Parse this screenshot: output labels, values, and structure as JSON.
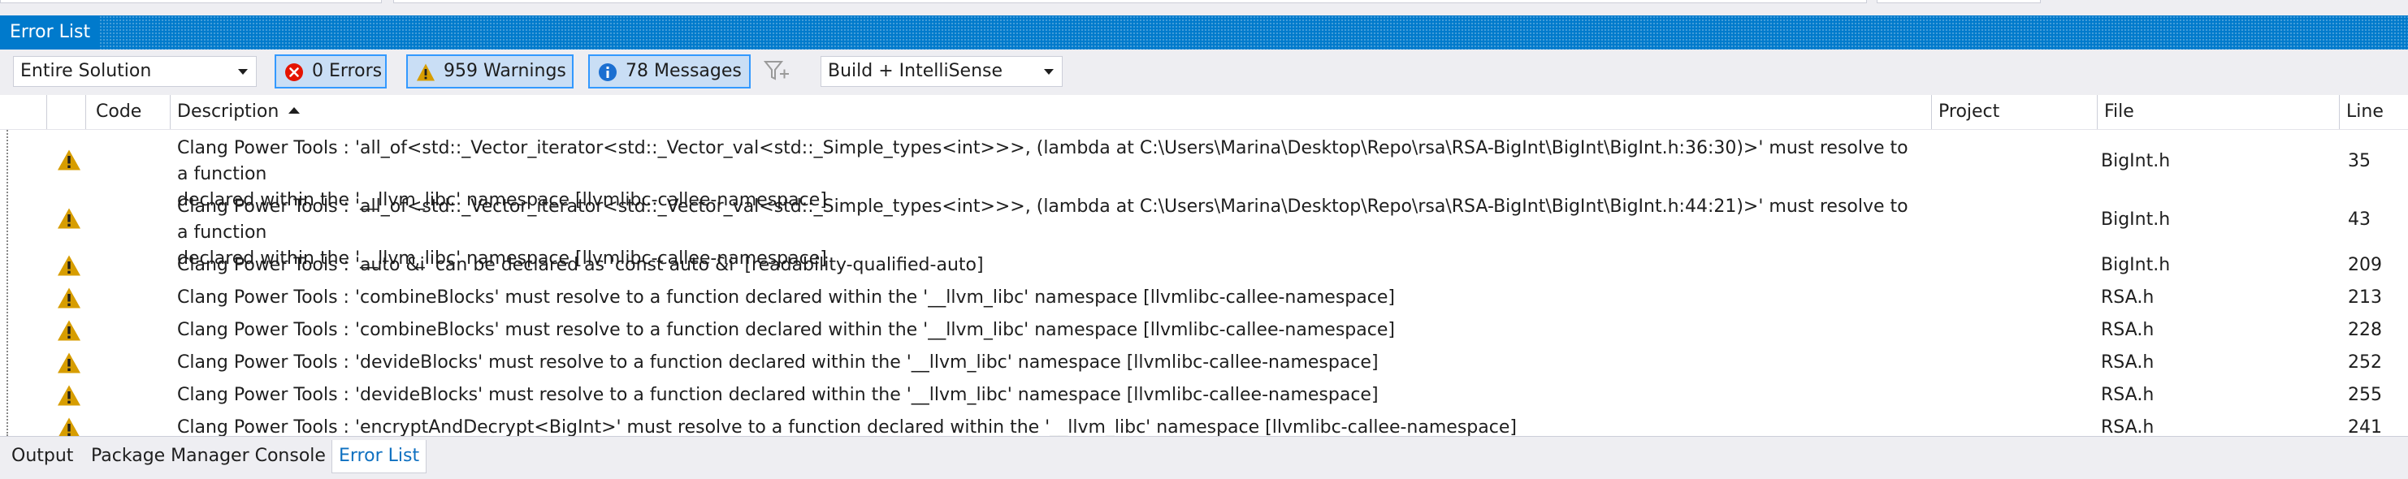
{
  "panel": {
    "title": "Error List"
  },
  "toolbar": {
    "scope_value": "Entire Solution",
    "errors_label": "0 Errors",
    "warnings_label": "959 Warnings",
    "messages_label": "78 Messages",
    "source_value": "Build + IntelliSense"
  },
  "columns": {
    "code": "Code",
    "description": "Description",
    "project": "Project",
    "file": "File",
    "line": "Line"
  },
  "rows": [
    {
      "desc1": "Clang Power Tools : 'all_of<std::_Vector_iterator<std::_Vector_val<std::_Simple_types<int>>>, (lambda at C:\\Users\\Marina\\Desktop\\Repo\\rsa\\RSA-BigInt\\BigInt\\BigInt.h:36:30)>' must resolve to a function",
      "desc2": "declared within the '__llvm_libc' namespace [llvmlibc-callee-namespace]",
      "project": "",
      "file": "BigInt.h",
      "line": "35"
    },
    {
      "desc1": "Clang Power Tools : 'all_of<std::_Vector_iterator<std::_Vector_val<std::_Simple_types<int>>>, (lambda at C:\\Users\\Marina\\Desktop\\Repo\\rsa\\RSA-BigInt\\BigInt\\BigInt.h:44:21)>' must resolve to a function",
      "desc2": "declared within the '__llvm_libc' namespace [llvmlibc-callee-namespace]",
      "project": "",
      "file": "BigInt.h",
      "line": "43"
    },
    {
      "desc1": "Clang Power Tools : 'auto &i' can be declared as 'const auto &i' [readability-qualified-auto]",
      "desc2": "",
      "project": "",
      "file": "BigInt.h",
      "line": "209"
    },
    {
      "desc1": "Clang Power Tools : 'combineBlocks' must resolve to a function declared within the '__llvm_libc' namespace [llvmlibc-callee-namespace]",
      "desc2": "",
      "project": "",
      "file": "RSA.h",
      "line": "213"
    },
    {
      "desc1": "Clang Power Tools : 'combineBlocks' must resolve to a function declared within the '__llvm_libc' namespace [llvmlibc-callee-namespace]",
      "desc2": "",
      "project": "",
      "file": "RSA.h",
      "line": "228"
    },
    {
      "desc1": "Clang Power Tools : 'devideBlocks' must resolve to a function declared within the '__llvm_libc' namespace [llvmlibc-callee-namespace]",
      "desc2": "",
      "project": "",
      "file": "RSA.h",
      "line": "252"
    },
    {
      "desc1": "Clang Power Tools : 'devideBlocks' must resolve to a function declared within the '__llvm_libc' namespace [llvmlibc-callee-namespace]",
      "desc2": "",
      "project": "",
      "file": "RSA.h",
      "line": "255"
    },
    {
      "desc1": "Clang Power Tools : 'encryptAndDecrypt<BigInt>' must resolve to a function declared within the '__llvm_libc' namespace [llvmlibc-callee-namespace]",
      "desc2": "",
      "project": "",
      "file": "RSA.h",
      "line": "241"
    }
  ],
  "bottom_tabs": [
    "Output",
    "Package Manager Console",
    "Error List"
  ],
  "colors": {
    "accent": "#007acc",
    "warning": "#d79d00",
    "error": "#e51400",
    "info": "#1ba1e2",
    "active_tab_text": "#0e70c0"
  }
}
